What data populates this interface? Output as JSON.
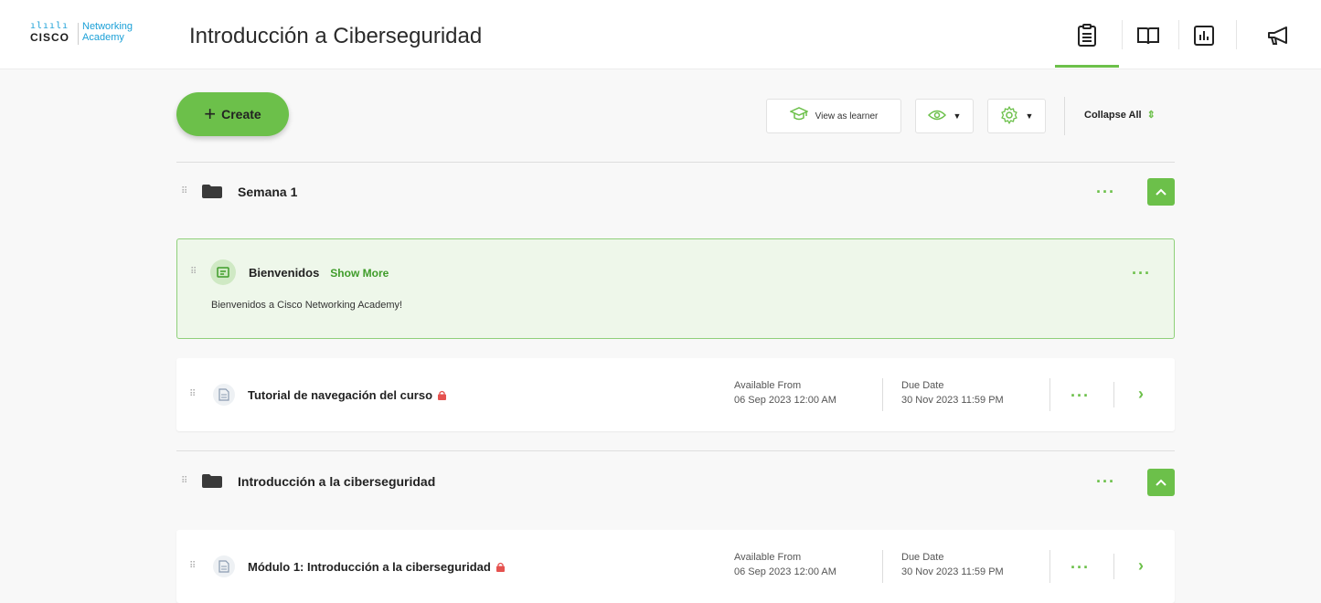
{
  "header": {
    "logo_bars": "ılıılı",
    "logo_cisco": "CISCO",
    "logo_line1": "Networking",
    "logo_line2": "Academy",
    "course_title": "Introducción a Ciberseguridad",
    "nav_icons": [
      "clipboard-icon",
      "book-icon",
      "chart-icon",
      "megaphone-icon"
    ]
  },
  "toolbar": {
    "create_label": "Create",
    "view_learner_label": "View as learner",
    "collapse_label": "Collapse All"
  },
  "sections": [
    {
      "title": "Semana 1",
      "items": [
        {
          "title": "Bienvenidos",
          "show_more": "Show More",
          "description": "Bienvenidos a Cisco Networking Academy!"
        },
        {
          "title": "Tutorial de navegación del curso",
          "available_label": "Available From",
          "available_value": "06 Sep 2023 12:00 AM",
          "due_label": "Due Date",
          "due_value": "30 Nov 2023 11:59 PM"
        }
      ]
    },
    {
      "title": "Introducción a la ciberseguridad",
      "items": [
        {
          "title": "Módulo 1: Introducción a la ciberseguridad",
          "available_label": "Available From",
          "available_value": "06 Sep 2023 12:00 AM",
          "due_label": "Due Date",
          "due_value": "30 Nov 2023 11:59 PM"
        }
      ]
    }
  ],
  "colors": {
    "accent": "#6cc04a",
    "accent_dark": "#3f9c2a",
    "card_green_bg": "#eef7ea",
    "lock": "#e5524f"
  }
}
